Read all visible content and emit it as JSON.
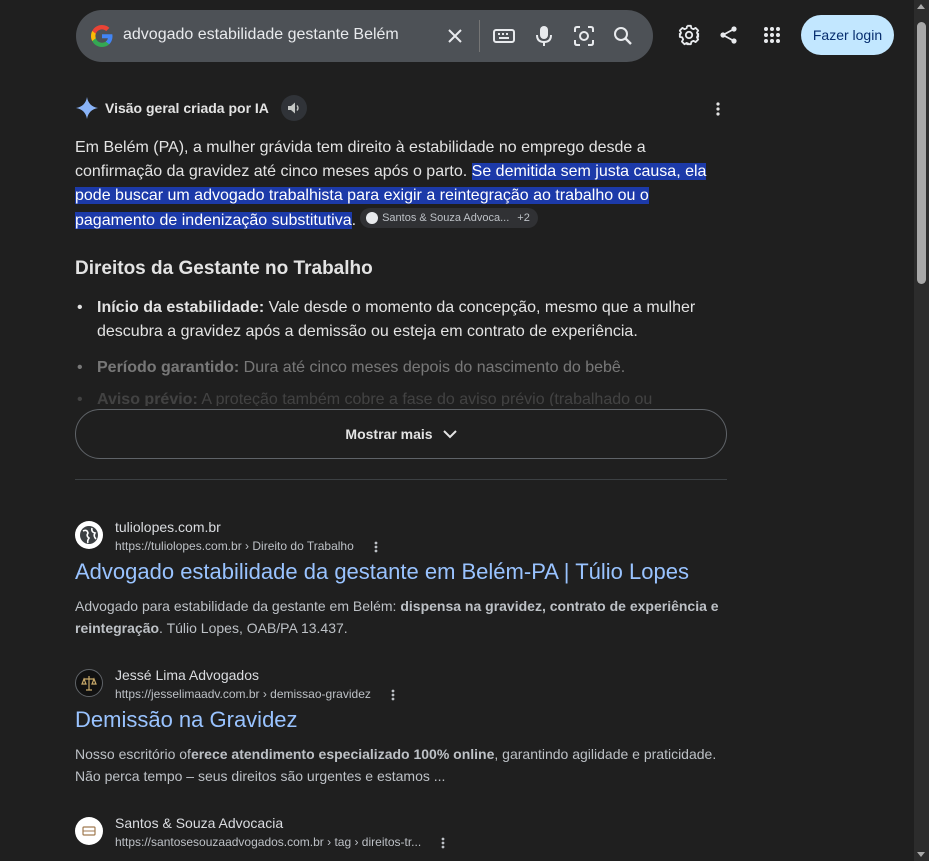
{
  "search": {
    "query": "advogado estabilidade gestante Belém"
  },
  "header": {
    "login_label": "Fazer login"
  },
  "ai_overview": {
    "title": "Visão geral criada por IA",
    "para_plain": "Em Belém (PA), a mulher grávida tem direito à estabilidade no emprego desde a confirmação da gravidez até cinco meses após o parto. ",
    "para_highlight": "Se demitida sem justa causa, ela pode buscar um advogado trabalhista para exigir a reintegração ao trabalho ou o pagamento de indenização substitutiva",
    "para_end": ".",
    "source_chip": "Santos & Souza Advoca...",
    "source_more": "+2",
    "heading": "Direitos da Gestante no Trabalho",
    "bullets": [
      {
        "bold": "Início da estabilidade:",
        "text": " Vale desde o momento da concepção, mesmo que a mulher descubra a gravidez após a demissão ou esteja em contrato de experiência."
      },
      {
        "bold": "Período garantido:",
        "text": " Dura até cinco meses depois do nascimento do bebê."
      },
      {
        "bold": "Aviso prévio:",
        "text": " A proteção também cobre a fase do aviso prévio (trabalhado ou"
      }
    ],
    "show_more": "Mostrar mais"
  },
  "results": [
    {
      "site": "tuliolopes.com.br",
      "url": "https://tuliolopes.com.br › Direito do Trabalho",
      "title": "Advogado estabilidade da gestante em Belém-PA | Túlio Lopes",
      "snippet_a": "Advogado para estabilidade da gestante em Belém: ",
      "snippet_b": "dispensa na gravidez, contrato de experiência e reintegração",
      "snippet_c": ". Túlio Lopes, OAB/PA 13.437.",
      "favicon": "globe-icon"
    },
    {
      "site": "Jessé Lima Advogados",
      "url": "https://jesselimaadv.com.br › demissao-gravidez",
      "title": "Demissão na Gravidez",
      "snippet_a": "Nosso escritório of",
      "snippet_b": "erece atendimento especializado 100% online",
      "snippet_c": ", garantindo agilidade e praticidade. Não perca tempo – seus direitos são urgentes e estamos ...",
      "favicon": "scales-logo-icon"
    },
    {
      "site": "Santos & Souza Advocacia",
      "url": "https://santosesouzaadvogados.com.br › tag › direitos-tr...",
      "title": "",
      "favicon": "firm-logo-icon"
    }
  ],
  "colors": {
    "background": "#1f1f1f",
    "search_bg": "#4d5156",
    "link": "#99c3ff",
    "highlight": "#1c3aa9",
    "login_bg": "#c2e7ff"
  }
}
